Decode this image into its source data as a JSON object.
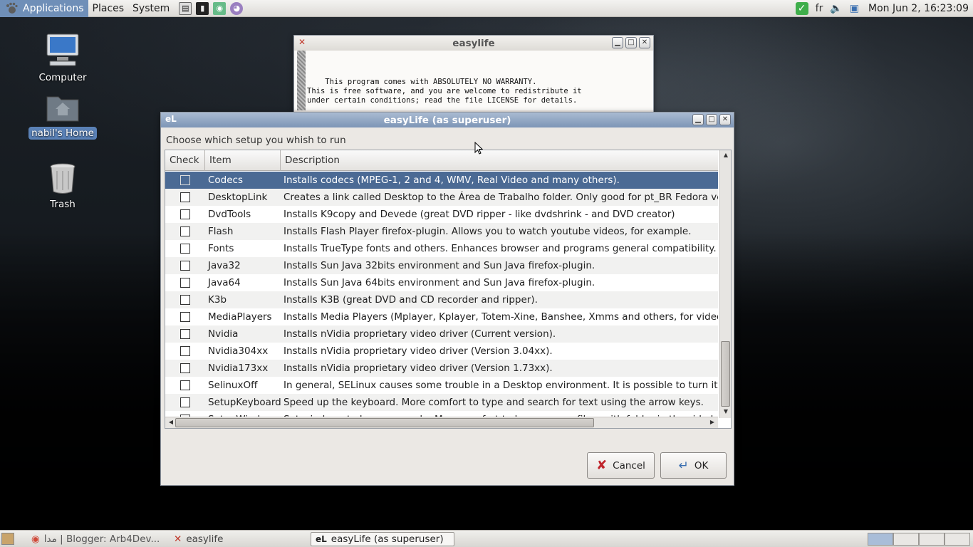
{
  "top_panel": {
    "menus": [
      "Applications",
      "Places",
      "System"
    ],
    "launchers": [
      "file-manager-icon",
      "terminal-icon",
      "network-icon",
      "pidgin-icon"
    ],
    "tray": {
      "keyboard_layout": "fr",
      "clock": "Mon Jun  2, 16:23:09"
    }
  },
  "desktop": {
    "icons": [
      {
        "label": "Computer"
      },
      {
        "label": "nabil's Home"
      },
      {
        "label": "Trash"
      }
    ]
  },
  "back_window": {
    "title": "easylife",
    "text": "This program comes with ABSOLUTELY NO WARRANTY.\nThis is free software, and you are welcome to redistribute it\nunder certain conditions; read the file LICENSE for details."
  },
  "dialog": {
    "app_badge": "eL",
    "title": "easyLife (as superuser)",
    "prompt": "Choose which setup you whish to run",
    "columns": [
      "Check",
      "Item",
      "Description"
    ],
    "rows": [
      {
        "item": "Codecs",
        "desc": "Installs codecs (MPEG-1, 2 and 4, WMV, Real Video and many others).",
        "selected": true
      },
      {
        "item": "DesktopLink",
        "desc": "Creates a link called Desktop to the Área de Trabalho folder. Only good for pt_BR Fedora versi"
      },
      {
        "item": "DvdTools",
        "desc": "Installs K9copy and Devede (great DVD ripper - like dvdshrink - and DVD creator)"
      },
      {
        "item": "Flash",
        "desc": "Installs Flash Player firefox-plugin. Allows you to watch youtube videos, for example."
      },
      {
        "item": "Fonts",
        "desc": "Installs TrueType fonts and others. Enhances browser and programs general compatibility."
      },
      {
        "item": "Java32",
        "desc": "Installs Sun Java 32bits environment and Sun Java firefox-plugin."
      },
      {
        "item": "Java64",
        "desc": "Installs Sun Java 64bits environment and Sun Java firefox-plugin."
      },
      {
        "item": "K3b",
        "desc": "Installs K3B (great DVD and CD recorder and ripper)."
      },
      {
        "item": "MediaPlayers",
        "desc": "Installs Media Players (Mplayer, Kplayer, Totem-Xine, Banshee, Xmms and others, for video ar"
      },
      {
        "item": "Nvidia",
        "desc": "Installs nVidia proprietary video driver (Current version)."
      },
      {
        "item": "Nvidia304xx",
        "desc": "Installs nVidia proprietary video driver (Version 3.04xx)."
      },
      {
        "item": "Nvidia173xx",
        "desc": "Installs nVidia proprietary video driver (Version 1.73xx)."
      },
      {
        "item": "SelinuxOff",
        "desc": "In general, SELinux causes some trouble in a Desktop environment. It is possible to turn it off"
      },
      {
        "item": "SetupKeyboard",
        "desc": "Speed up the keyboard. More comfort to type and search for text using the arrow keys."
      },
      {
        "item": "SetupWindows",
        "desc": "Set windows to browser mode. More comfort to browse your files, with folder in the side bar."
      }
    ],
    "cancel_label": "Cancel",
    "ok_label": "OK"
  },
  "taskbar": {
    "tasks": [
      {
        "label": "مدا | Blogger: Arb4Dev..."
      },
      {
        "label": "easylife"
      },
      {
        "label": "easyLife (as superuser)"
      }
    ]
  },
  "colors": {
    "selection": "#4b6a94",
    "active_titlebar": "#7d95b6",
    "menu_active": "#6f8fb8"
  }
}
